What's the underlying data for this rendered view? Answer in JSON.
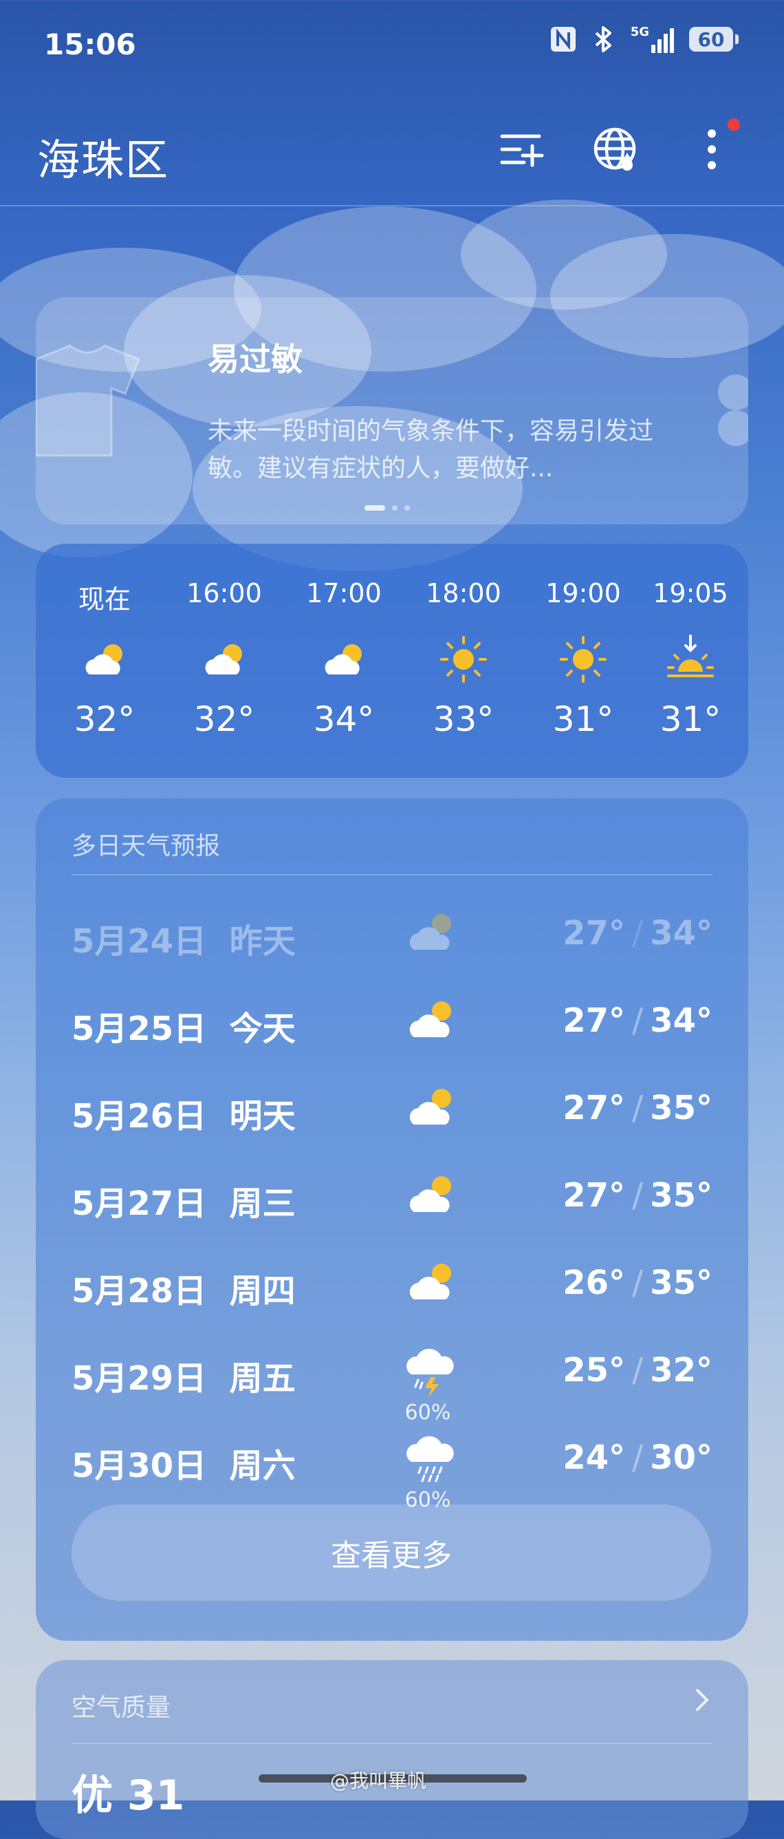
{
  "status_bar": {
    "time": "15:06",
    "network": "5G",
    "battery": "60"
  },
  "header": {
    "city": "海珠区"
  },
  "tip": {
    "title": "易过敏",
    "text": "未来一段时间的气象条件下，容易引发过敏。建议有症状的人，要做好..."
  },
  "hourly": [
    {
      "time": "现在",
      "icon": "partly-cloudy-icon",
      "temp": "32°"
    },
    {
      "time": "16:00",
      "icon": "partly-cloudy-icon",
      "temp": "32°"
    },
    {
      "time": "17:00",
      "icon": "partly-cloudy-icon",
      "temp": "34°"
    },
    {
      "time": "18:00",
      "icon": "sunny-icon",
      "temp": "33°"
    },
    {
      "time": "19:00",
      "icon": "sunny-icon",
      "temp": "31°"
    },
    {
      "time": "19:05",
      "icon": "sunset-icon",
      "temp": "31°"
    }
  ],
  "daily": {
    "title": "多日天气预报",
    "rows": [
      {
        "date": "5月24日",
        "day": "昨天",
        "icon": "partly-cloudy-icon",
        "precip": "",
        "low": "27°",
        "high": "34°"
      },
      {
        "date": "5月25日",
        "day": "今天",
        "icon": "partly-cloudy-icon",
        "precip": "",
        "low": "27°",
        "high": "34°"
      },
      {
        "date": "5月26日",
        "day": "明天",
        "icon": "partly-cloudy-icon",
        "precip": "",
        "low": "27°",
        "high": "35°"
      },
      {
        "date": "5月27日",
        "day": "周三",
        "icon": "partly-cloudy-icon",
        "precip": "",
        "low": "27°",
        "high": "35°"
      },
      {
        "date": "5月28日",
        "day": "周四",
        "icon": "partly-cloudy-icon",
        "precip": "",
        "low": "26°",
        "high": "35°"
      },
      {
        "date": "5月29日",
        "day": "周五",
        "icon": "thunderstorm-icon",
        "precip": "60%",
        "low": "25°",
        "high": "32°"
      },
      {
        "date": "5月30日",
        "day": "周六",
        "icon": "rain-icon",
        "precip": "60%",
        "low": "24°",
        "high": "30°"
      }
    ],
    "more_label": "查看更多"
  },
  "air_quality": {
    "title": "空气质量",
    "value": "优 31"
  },
  "watermark": "@我叫畢帆",
  "colors": {
    "notification_dot": "#f13b3b",
    "sun": "#f7c02b"
  }
}
